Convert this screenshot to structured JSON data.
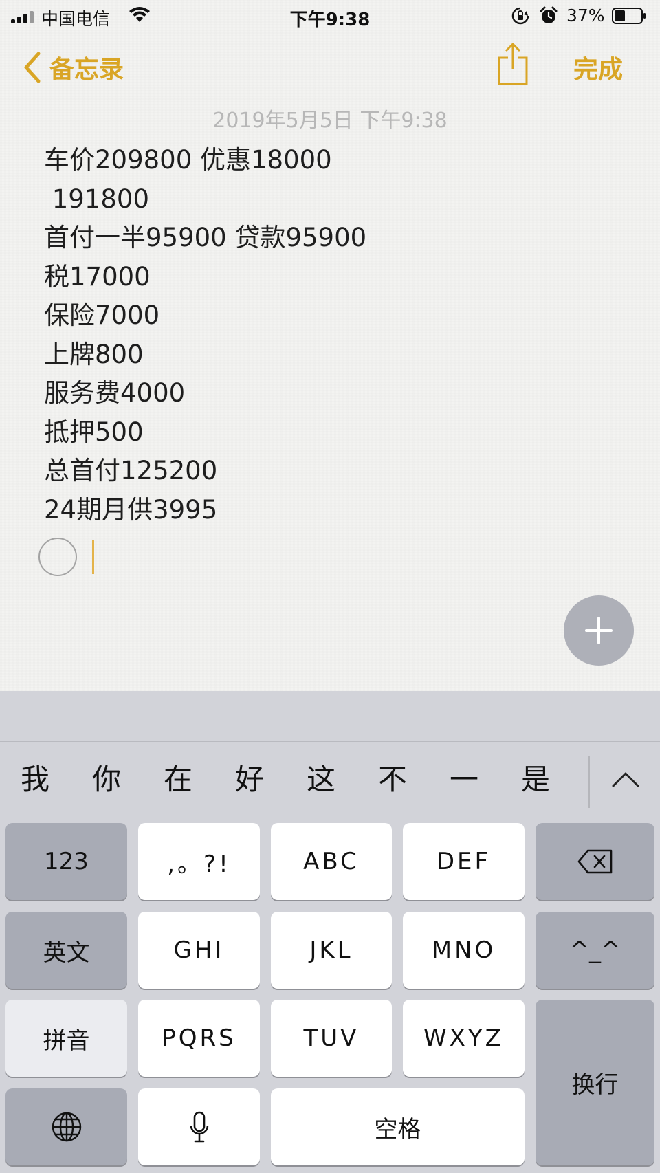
{
  "status_bar": {
    "carrier": "中国电信",
    "time": "下午9:38",
    "battery_percent": "37%"
  },
  "nav": {
    "back_label": "备忘录",
    "done_label": "完成",
    "accent_color": "#d9a525"
  },
  "note": {
    "date": "2019年5月5日 下午9:38",
    "lines": [
      "车价209800 优惠18000",
      " 191800",
      "首付一半95900 贷款95900",
      "税17000",
      "保险7000",
      "上牌800",
      "服务费4000",
      "抵押500",
      "总首付125200",
      "24期月供3995"
    ]
  },
  "keyboard": {
    "candidates": [
      "我",
      "你",
      "在",
      "好",
      "这",
      "不",
      "一",
      "是"
    ],
    "keys": {
      "numbers": "123",
      "punct": ",。?!",
      "abc": "ABC",
      "def": "DEF",
      "english": "英文",
      "ghi": "GHI",
      "jkl": "JKL",
      "mno": "MNO",
      "emoticon": "^_^",
      "pinyin": "拼音",
      "pqrs": "PQRS",
      "tuv": "TUV",
      "wxyz": "WXYZ",
      "return": "换行",
      "space": "空格"
    }
  }
}
